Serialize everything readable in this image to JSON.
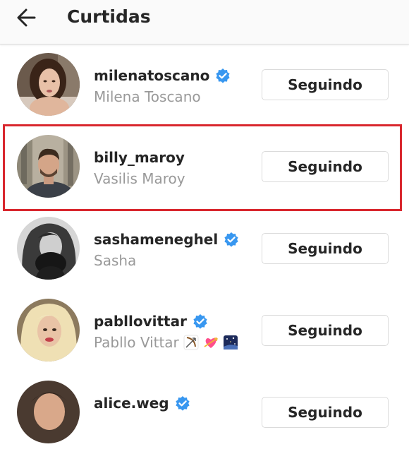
{
  "header": {
    "title": "Curtidas",
    "back_icon": "arrow-left-icon"
  },
  "accent_color": "#3897f0",
  "highlight_color": "#d9272e",
  "users": [
    {
      "username": "milenatoscano",
      "full_name": "Milena Toscano",
      "verified": true,
      "button_label": "Seguindo",
      "emojis": []
    },
    {
      "username": "billy_maroy",
      "full_name": "Vasilis Maroy",
      "verified": false,
      "button_label": "Seguindo",
      "emojis": [],
      "highlighted": true
    },
    {
      "username": "sashameneghel",
      "full_name": "Sasha",
      "verified": true,
      "button_label": "Seguindo",
      "emojis": []
    },
    {
      "username": "pabllovittar",
      "full_name": "Pabllo Vittar",
      "verified": true,
      "button_label": "Seguindo",
      "emojis": [
        "bow-and-arrow-emoji",
        "heart-with-arrow-emoji",
        "night-sky-emoji"
      ]
    },
    {
      "username": "alice.weg",
      "full_name": "",
      "verified": true,
      "button_label": "Seguindo",
      "emojis": []
    }
  ]
}
